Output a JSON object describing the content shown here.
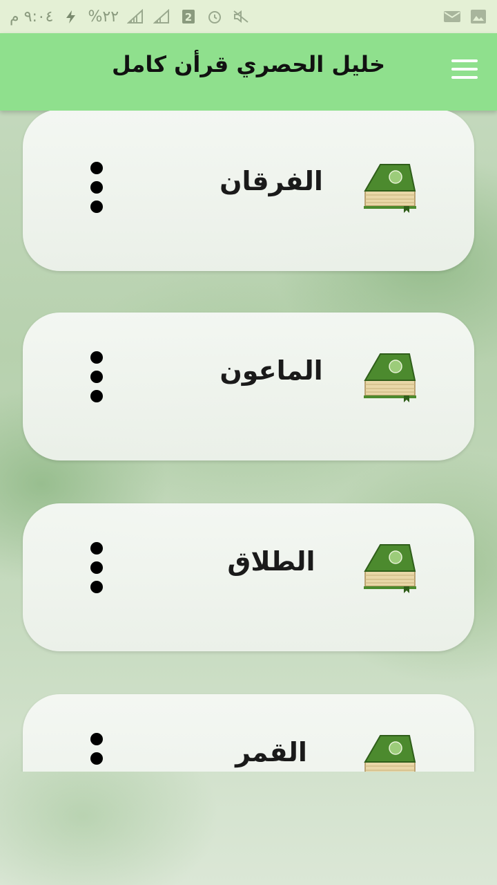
{
  "status_bar": {
    "time": "٩:٠٤ م",
    "battery": "٢٢%",
    "icons": [
      "notification-mail-icon",
      "notification-image-icon",
      "mute-icon",
      "alarm-icon",
      "sim-2-icon",
      "signal-icon",
      "signal-icon",
      "charging-icon"
    ]
  },
  "app_bar": {
    "title": "خليل الحصري قرأن كامل",
    "menu_icon": "hamburger-menu-icon"
  },
  "surahs": [
    {
      "name": "الفرقان"
    },
    {
      "name": "الماعون"
    },
    {
      "name": "الطلاق"
    },
    {
      "name": "القمر"
    }
  ],
  "colors": {
    "app_bar": "#8fe08d",
    "status_bar": "#e4f0d5",
    "book_cover": "#4c8a2e"
  }
}
